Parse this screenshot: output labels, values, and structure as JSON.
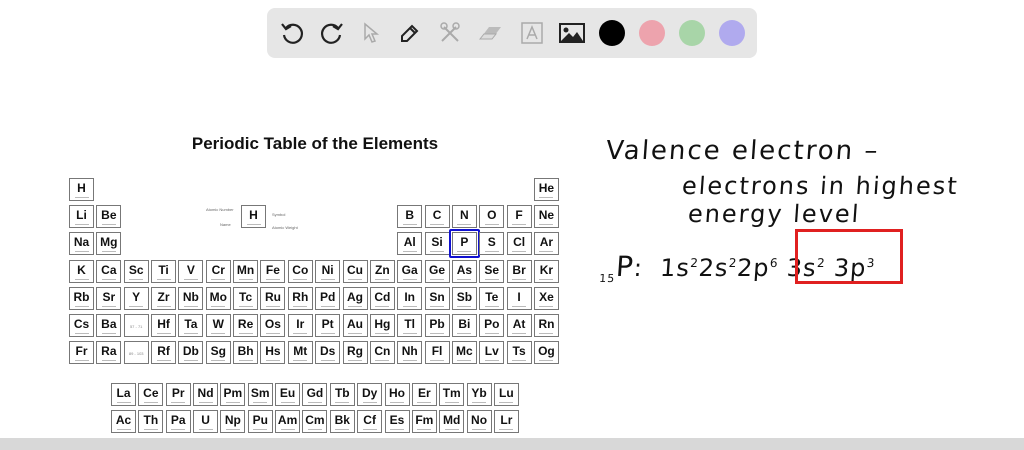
{
  "toolbar": {
    "tools": [
      "undo-icon",
      "redo-icon",
      "select-icon",
      "pen-icon",
      "tools-icon",
      "eraser-icon",
      "text-icon",
      "image-icon"
    ],
    "colors": [
      "#000000",
      "#eda3ad",
      "#a8d5a8",
      "#b0aaee"
    ]
  },
  "table": {
    "title": "Periodic Table of the Elements",
    "rows": [
      [
        "H",
        "",
        "",
        "",
        "",
        "",
        "",
        "",
        "",
        "",
        "",
        "",
        "",
        "",
        "",
        "",
        "",
        "He"
      ],
      [
        "Li",
        "Be",
        "",
        "",
        "",
        "",
        "",
        "",
        "",
        "",
        "",
        "",
        "B",
        "C",
        "N",
        "O",
        "F",
        "Ne"
      ],
      [
        "Na",
        "Mg",
        "",
        "",
        "",
        "",
        "",
        "",
        "",
        "",
        "",
        "",
        "Al",
        "Si",
        "P",
        "S",
        "Cl",
        "Ar"
      ],
      [
        "K",
        "Ca",
        "Sc",
        "Ti",
        "V",
        "Cr",
        "Mn",
        "Fe",
        "Co",
        "Ni",
        "Cu",
        "Zn",
        "Ga",
        "Ge",
        "As",
        "Se",
        "Br",
        "Kr"
      ],
      [
        "Rb",
        "Sr",
        "Y",
        "Zr",
        "Nb",
        "Mo",
        "Tc",
        "Ru",
        "Rh",
        "Pd",
        "Ag",
        "Cd",
        "In",
        "Sn",
        "Sb",
        "Te",
        "I",
        "Xe"
      ],
      [
        "Cs",
        "Ba",
        "57 - 71",
        "Hf",
        "Ta",
        "W",
        "Re",
        "Os",
        "Ir",
        "Pt",
        "Au",
        "Hg",
        "Tl",
        "Pb",
        "Bi",
        "Po",
        "At",
        "Rn"
      ],
      [
        "Fr",
        "Ra",
        "89 - 103",
        "Rf",
        "Db",
        "Sg",
        "Bh",
        "Hs",
        "Mt",
        "Ds",
        "Rg",
        "Cn",
        "Nh",
        "Fl",
        "Mc",
        "Lv",
        "Ts",
        "Og"
      ]
    ],
    "lanthanides": [
      "La",
      "Ce",
      "Pr",
      "Nd",
      "Pm",
      "Sm",
      "Eu",
      "Gd",
      "Tb",
      "Dy",
      "Ho",
      "Er",
      "Tm",
      "Yb",
      "Lu"
    ],
    "actinides": [
      "Ac",
      "Th",
      "Pa",
      "U",
      "Np",
      "Pu",
      "Am",
      "Cm",
      "Bk",
      "Cf",
      "Es",
      "Fm",
      "Md",
      "No",
      "Lr"
    ],
    "highlighted": "P",
    "legend": {
      "symbol": "H",
      "atomic_number": "Atomic Number",
      "name": "Name",
      "symbol_label": "Symbol",
      "atomic_weight": "Atomic Weight"
    }
  },
  "notes": {
    "line1": "Valence electron –",
    "line2": "electrons in highest",
    "line3": "energy level",
    "atomic_number": "15",
    "element": "P",
    "colon": ":",
    "config": [
      {
        "orb": "1s",
        "e": "2"
      },
      {
        "orb": "2s",
        "e": "2"
      },
      {
        "orb": "2p",
        "e": "6"
      }
    ],
    "valence": [
      {
        "orb": "3s",
        "e": "2"
      },
      {
        "orb": "3p",
        "e": "3"
      }
    ],
    "highlight_color": "#e02020"
  }
}
